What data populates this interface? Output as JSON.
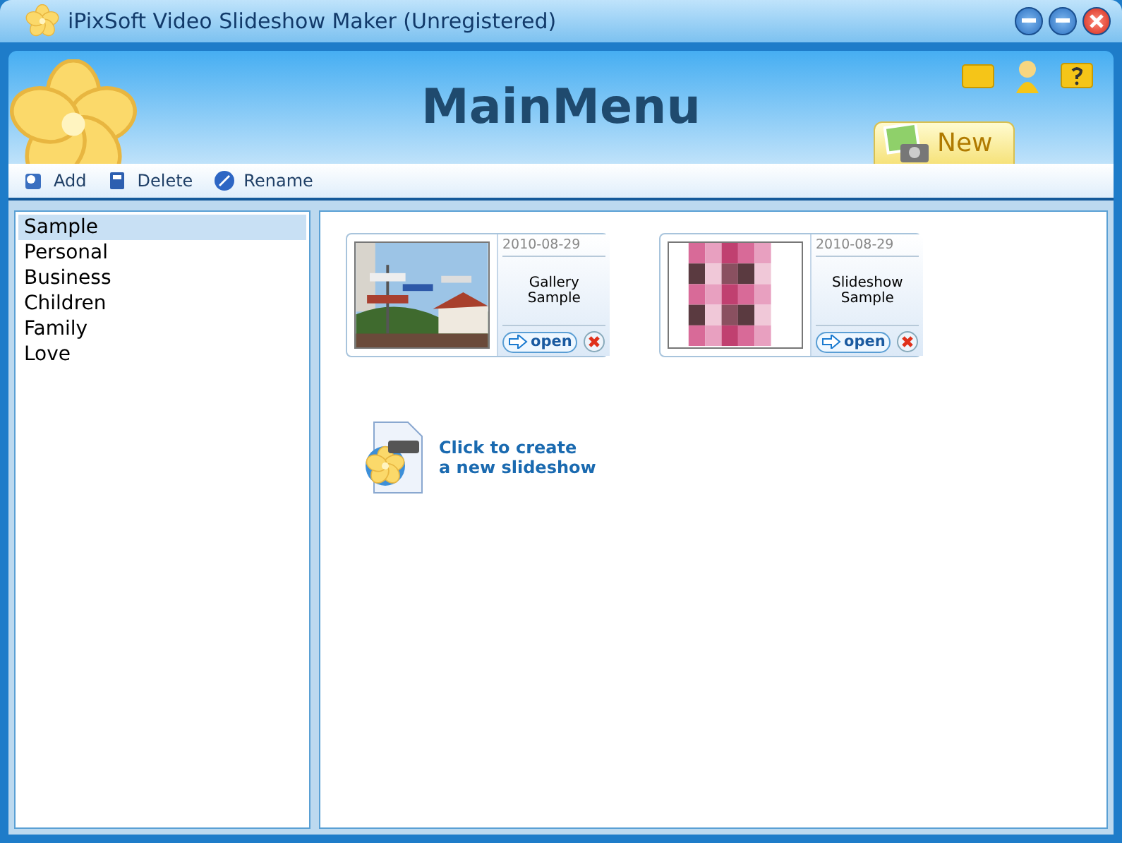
{
  "window": {
    "title": "iPixSoft Video Slideshow Maker (Unregistered)"
  },
  "header": {
    "title": "MainMenu",
    "new_tab": "New"
  },
  "toolbar": [
    "Add",
    "Delete",
    "Rename"
  ],
  "categories": [
    {
      "label": "Sample",
      "selected": true
    },
    {
      "label": "Personal",
      "selected": false
    },
    {
      "label": "Business",
      "selected": false
    },
    {
      "label": "Children",
      "selected": false
    },
    {
      "label": "Family",
      "selected": false
    },
    {
      "label": "Love",
      "selected": false
    }
  ],
  "projects": [
    {
      "date": "2010-08-29",
      "title": "Gallery Sample",
      "open": "open",
      "picture": {
        "kind": "street"
      }
    },
    {
      "date": "2010-08-29",
      "title": "Slideshow Sample",
      "open": "open",
      "picture": {
        "kind": "grid"
      }
    }
  ],
  "create": {
    "line1": "Click to create",
    "line2": "a new slideshow"
  }
}
